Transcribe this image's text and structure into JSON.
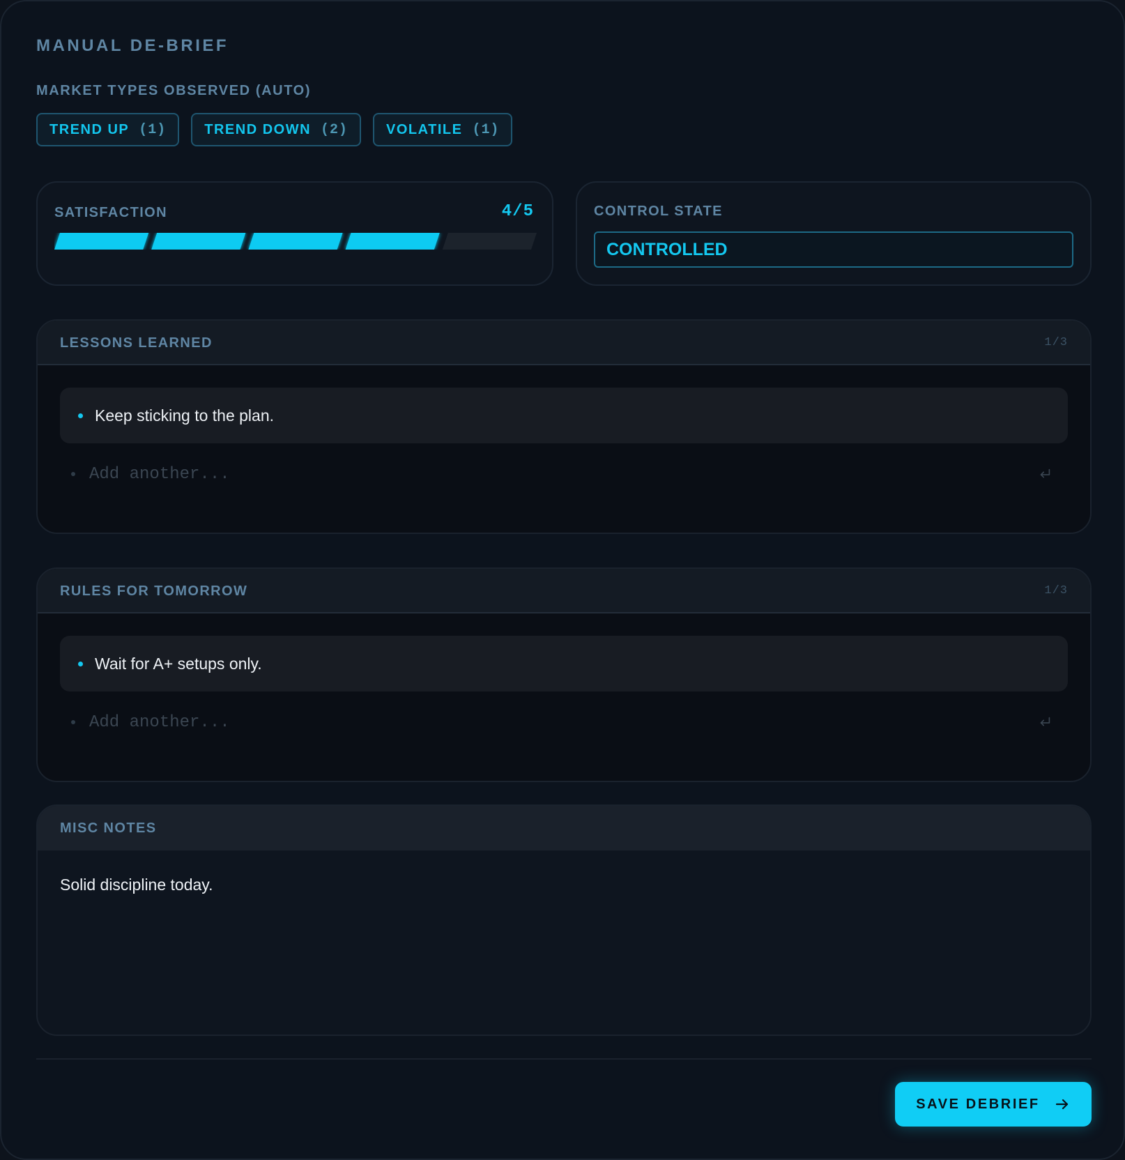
{
  "page": {
    "title": "MANUAL DE-BRIEF"
  },
  "market_types": {
    "label": "MARKET TYPES OBSERVED (AUTO)",
    "tags": [
      {
        "name": "TREND UP",
        "count": "(1)"
      },
      {
        "name": "TREND DOWN",
        "count": "(2)"
      },
      {
        "name": "VOLATILE",
        "count": "(1)"
      }
    ]
  },
  "satisfaction": {
    "label": "SATISFACTION",
    "value_text": "4/5",
    "value": 4,
    "max": 5,
    "filled_color": "#0ecbf2",
    "empty_color": "#1c232c"
  },
  "control_state": {
    "label": "CONTROL STATE",
    "value": "CONTROLLED"
  },
  "lessons": {
    "label": "LESSONS LEARNED",
    "count": "1/3",
    "items": [
      "Keep sticking to the plan."
    ],
    "add_placeholder": "Add another..."
  },
  "rules": {
    "label": "RULES FOR TOMORROW",
    "count": "1/3",
    "items": [
      "Wait for A+ setups only."
    ],
    "add_placeholder": "Add another..."
  },
  "misc": {
    "label": "MISC NOTES",
    "text": "Solid discipline today."
  },
  "actions": {
    "save_label": "SAVE DEBRIEF"
  },
  "icons": {
    "enter": "enter-return-icon",
    "save": "arrow-right-icon"
  },
  "colors": {
    "accent": "#10cdf5",
    "label": "#5f86a4",
    "background": "#0c131d"
  }
}
